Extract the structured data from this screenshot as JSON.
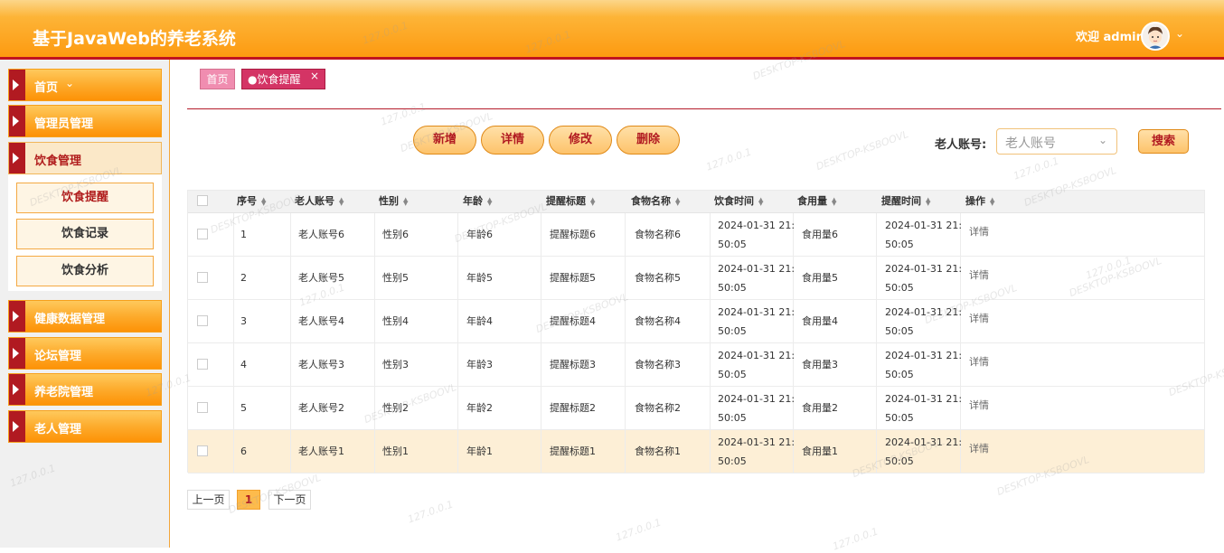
{
  "header": {
    "title": "基于JavaWeb的养老系统",
    "welcome": "欢迎 admin"
  },
  "sidebar": {
    "items": [
      {
        "label": "首页"
      },
      {
        "label": "管理员管理"
      },
      {
        "label": "饮食管理"
      },
      {
        "label": "健康数据管理"
      },
      {
        "label": "论坛管理"
      },
      {
        "label": "养老院管理"
      },
      {
        "label": "老人管理"
      }
    ],
    "sub_items": [
      {
        "label": "饮食提醒"
      },
      {
        "label": "饮食记录"
      },
      {
        "label": "饮食分析"
      }
    ]
  },
  "tabs": {
    "home": "首页",
    "current": "●饮食提醒",
    "close": "×"
  },
  "toolbar": {
    "add": "新增",
    "detail": "详情",
    "edit": "修改",
    "delete": "删除"
  },
  "search": {
    "label": "老人账号:",
    "placeholder": "老人账号",
    "button": "搜索"
  },
  "table": {
    "columns": [
      "序号",
      "老人账号",
      "性别",
      "年龄",
      "提醒标题",
      "食物名称",
      "饮食时间",
      "食用量",
      "提醒时间",
      "操作"
    ],
    "rows": [
      {
        "no": "1",
        "account": "老人账号6",
        "gender": "性别6",
        "age": "年龄6",
        "title": "提醒标题6",
        "food": "食物名称6",
        "time1a": "2024-01-31 21:",
        "time1b": "50:05",
        "amount": "食用量6",
        "time2a": "2024-01-31 21:",
        "time2b": "50:05",
        "op": "详情"
      },
      {
        "no": "2",
        "account": "老人账号5",
        "gender": "性别5",
        "age": "年龄5",
        "title": "提醒标题5",
        "food": "食物名称5",
        "time1a": "2024-01-31 21:",
        "time1b": "50:05",
        "amount": "食用量5",
        "time2a": "2024-01-31 21:",
        "time2b": "50:05",
        "op": "详情"
      },
      {
        "no": "3",
        "account": "老人账号4",
        "gender": "性别4",
        "age": "年龄4",
        "title": "提醒标题4",
        "food": "食物名称4",
        "time1a": "2024-01-31 21:",
        "time1b": "50:05",
        "amount": "食用量4",
        "time2a": "2024-01-31 21:",
        "time2b": "50:05",
        "op": "详情"
      },
      {
        "no": "4",
        "account": "老人账号3",
        "gender": "性别3",
        "age": "年龄3",
        "title": "提醒标题3",
        "food": "食物名称3",
        "time1a": "2024-01-31 21:",
        "time1b": "50:05",
        "amount": "食用量3",
        "time2a": "2024-01-31 21:",
        "time2b": "50:05",
        "op": "详情"
      },
      {
        "no": "5",
        "account": "老人账号2",
        "gender": "性别2",
        "age": "年龄2",
        "title": "提醒标题2",
        "food": "食物名称2",
        "time1a": "2024-01-31 21:",
        "time1b": "50:05",
        "amount": "食用量2",
        "time2a": "2024-01-31 21:",
        "time2b": "50:05",
        "op": "详情"
      },
      {
        "no": "6",
        "account": "老人账号1",
        "gender": "性别1",
        "age": "年龄1",
        "title": "提醒标题1",
        "food": "食物名称1",
        "time1a": "2024-01-31 21:",
        "time1b": "50:05",
        "amount": "食用量1",
        "time2a": "2024-01-31 21:",
        "time2b": "50:05",
        "op": "详情"
      }
    ]
  },
  "pagination": {
    "prev": "上一页",
    "page": "1",
    "next": "下一页"
  },
  "watermark": {
    "a": "127.0.0.1",
    "b": "DESKTOP-KSBOOVL"
  }
}
